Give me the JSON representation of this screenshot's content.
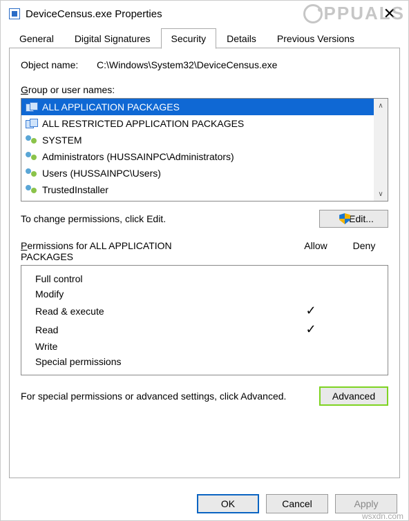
{
  "title": "DeviceCensus.exe Properties",
  "tabs": [
    "General",
    "Digital Signatures",
    "Security",
    "Details",
    "Previous Versions"
  ],
  "activeTab": 2,
  "objectNameLabel": "Object name:",
  "objectName": "C:\\Windows\\System32\\DeviceCensus.exe",
  "groupLabel": "Group or user names:",
  "principals": [
    {
      "name": "ALL APPLICATION PACKAGES",
      "icon": "pkg",
      "selected": true
    },
    {
      "name": "ALL RESTRICTED APPLICATION PACKAGES",
      "icon": "pkg",
      "selected": false
    },
    {
      "name": "SYSTEM",
      "icon": "user",
      "selected": false
    },
    {
      "name": "Administrators (HUSSAINPC\\Administrators)",
      "icon": "user",
      "selected": false
    },
    {
      "name": "Users (HUSSAINPC\\Users)",
      "icon": "user",
      "selected": false
    },
    {
      "name": "TrustedInstaller",
      "icon": "user",
      "selected": false
    }
  ],
  "editHint": "To change permissions, click Edit.",
  "editButton": "Edit...",
  "permHeader": "Permissions for ALL APPLICATION PACKAGES",
  "allowLabel": "Allow",
  "denyLabel": "Deny",
  "permissions": [
    {
      "name": "Full control",
      "allow": false,
      "deny": false
    },
    {
      "name": "Modify",
      "allow": false,
      "deny": false
    },
    {
      "name": "Read & execute",
      "allow": true,
      "deny": false
    },
    {
      "name": "Read",
      "allow": true,
      "deny": false
    },
    {
      "name": "Write",
      "allow": false,
      "deny": false
    },
    {
      "name": "Special permissions",
      "allow": false,
      "deny": false
    }
  ],
  "advText": "For special permissions or advanced settings, click Advanced.",
  "advButton": "Advanced",
  "buttons": {
    "ok": "OK",
    "cancel": "Cancel",
    "apply": "Apply"
  },
  "watermark": "PPUALS",
  "footer": "wsxdn.com"
}
